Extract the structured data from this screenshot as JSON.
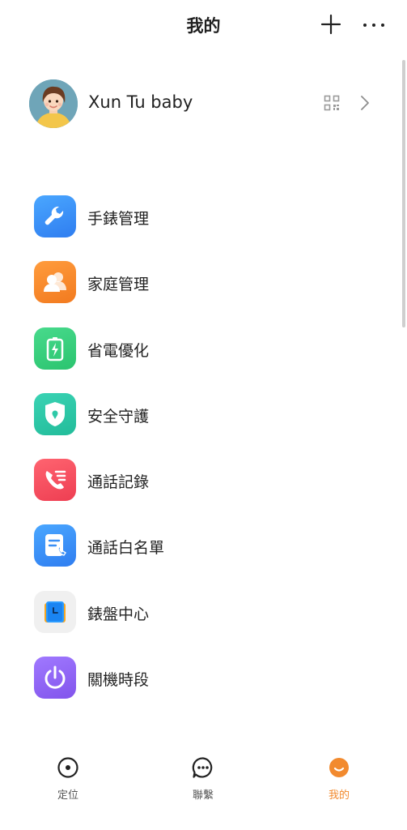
{
  "header": {
    "title": "我的"
  },
  "profile": {
    "name": "Xun Tu baby"
  },
  "menu": {
    "items": [
      {
        "label": "手錶管理",
        "icon": "wrench-icon",
        "color": "#3a8ff5"
      },
      {
        "label": "家庭管理",
        "icon": "family-icon",
        "color": "#f5872c"
      },
      {
        "label": "省電優化",
        "icon": "battery-icon",
        "color": "#35cf7d"
      },
      {
        "label": "安全守護",
        "icon": "shield-icon",
        "color": "#2ec9a8"
      },
      {
        "label": "通話記錄",
        "icon": "call-log-icon",
        "color": "#f0505e"
      },
      {
        "label": "通話白名單",
        "icon": "whitelist-icon",
        "color": "#3a8ff5"
      },
      {
        "label": "錶盤中心",
        "icon": "watch-face-icon",
        "color": "#f0f0f0"
      },
      {
        "label": "關機時段",
        "icon": "power-icon",
        "color": "#9065f2"
      }
    ]
  },
  "tabs": {
    "locate": "定位",
    "contact": "聯繫",
    "mine": "我的",
    "active": "mine",
    "active_color": "#f28a2e"
  }
}
